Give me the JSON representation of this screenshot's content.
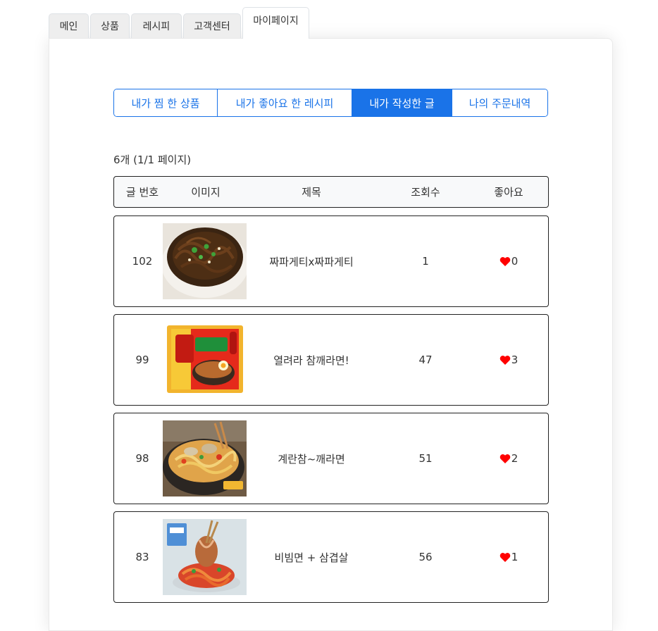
{
  "top_tabs": [
    {
      "label": "메인"
    },
    {
      "label": "상품"
    },
    {
      "label": "레시피"
    },
    {
      "label": "고객센터"
    },
    {
      "label": "마이페이지"
    }
  ],
  "sub_tabs": [
    {
      "label": "내가 찜 한 상품"
    },
    {
      "label": "내가 좋아요 한 레시피"
    },
    {
      "label": "내가 작성한 글"
    },
    {
      "label": "나의 주문내역"
    }
  ],
  "count_text": "6개 (1/1 페이지)",
  "table": {
    "headers": {
      "number": "글 번호",
      "image": "이미지",
      "title": "제목",
      "views": "조회수",
      "likes": "좋아요"
    },
    "rows": [
      {
        "number": "102",
        "title": "짜파게티x짜파게티",
        "views": "1",
        "likes": "0",
        "image": "jjapaghetti-photo"
      },
      {
        "number": "99",
        "title": "열려라 참깨라면!",
        "views": "47",
        "likes": "3",
        "image": "sesame-ramen-package"
      },
      {
        "number": "98",
        "title": "계란참~깨라면",
        "views": "51",
        "likes": "2",
        "image": "ramen-bowl-photo"
      },
      {
        "number": "83",
        "title": "비빔면 + 삼겹살",
        "views": "56",
        "likes": "1",
        "image": "bibimmyeon-photo"
      }
    ]
  },
  "colors": {
    "accent": "#1a73e8",
    "heart": "#ff0000"
  },
  "icons": {
    "like": "heart-icon"
  }
}
